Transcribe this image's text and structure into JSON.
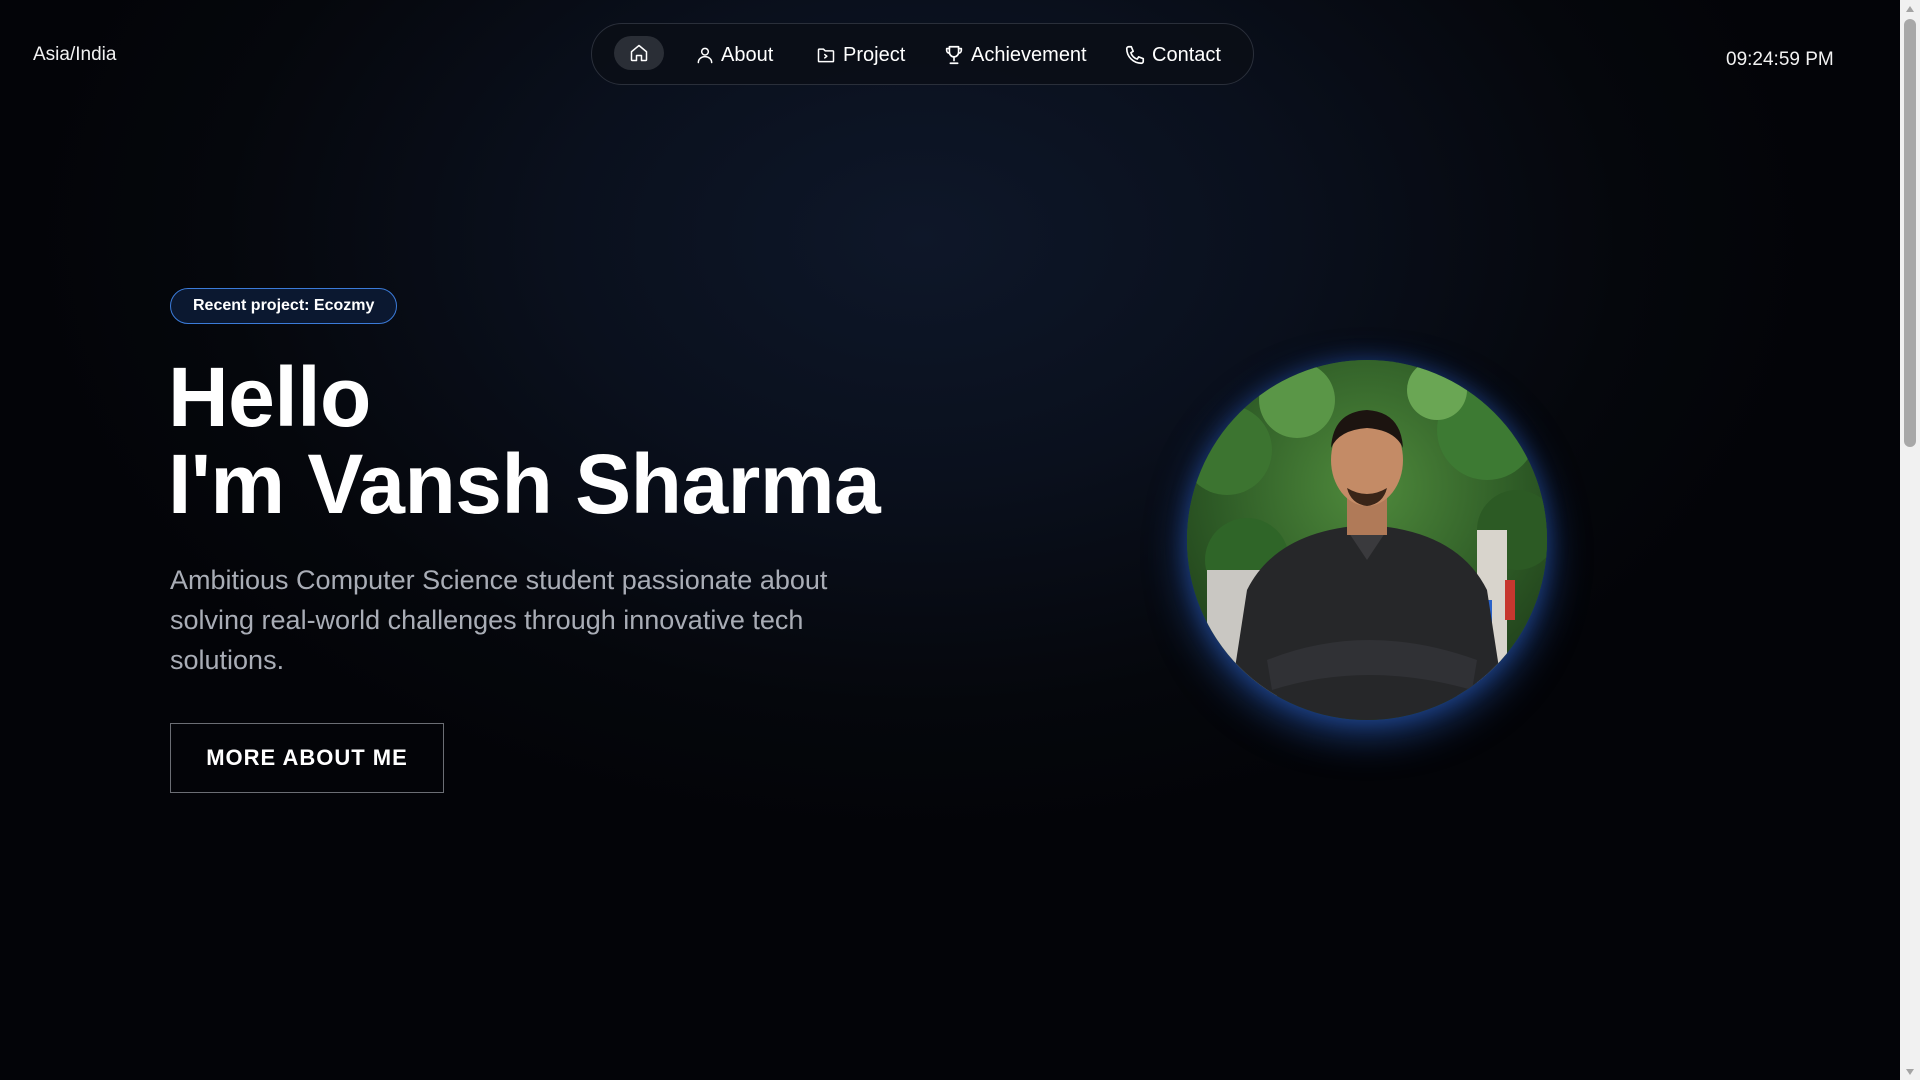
{
  "header": {
    "timezone": "Asia/India",
    "time": "09:24:59 PM"
  },
  "nav": {
    "items": [
      {
        "label": "",
        "icon": "home-icon"
      },
      {
        "label": "About",
        "icon": "user-icon"
      },
      {
        "label": "Project",
        "icon": "folder-icon"
      },
      {
        "label": "Achievement",
        "icon": "trophy-icon"
      },
      {
        "label": "Contact",
        "icon": "phone-icon"
      }
    ]
  },
  "hero": {
    "badge": "Recent project: Ecozmy",
    "greeting": "Hello",
    "name": "I'm Vansh Sharma",
    "description": "Ambitious Computer Science student passionate about solving real-world challenges through innovative tech solutions.",
    "cta_label": "MORE ABOUT ME"
  },
  "colors": {
    "accent": "#3b7bd9",
    "background": "#05070c",
    "text_muted": "#a9adb6"
  }
}
